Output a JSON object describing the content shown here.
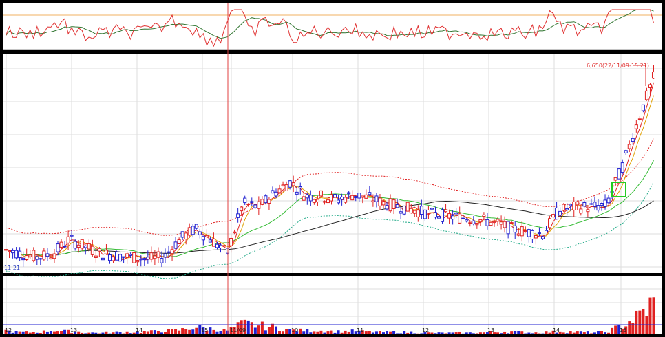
{
  "chart_data": {
    "type": "candlestick",
    "x_tick_labels": [
      "12",
      "13",
      "14",
      "15",
      "11/09",
      "10",
      "11",
      "12",
      "13",
      "14",
      "15"
    ],
    "price_annotation": "6,650(22/11/09-15:21)",
    "left_edge_label": "11:21",
    "grid": true,
    "panels": [
      "oscillator",
      "price",
      "volume"
    ],
    "colors": {
      "up": "#e02020",
      "down": "#2020d0",
      "ma_long": "#222222",
      "ma_mid": "#33bb33",
      "ma_short": "#e0a000",
      "band_upper": "#e02020",
      "band_lower": "#22aa88",
      "osc_fast": "#e03030",
      "osc_slow": "#337733",
      "cursor": "#e04040",
      "highlight_box": "#22cc22"
    },
    "close_approx": [
      5.0,
      4.9,
      4.8,
      4.9,
      5.3,
      5.1,
      4.9,
      4.85,
      4.8,
      4.75,
      4.8,
      5.3,
      5.6,
      5.3,
      4.9,
      6.3,
      6.2,
      6.6,
      6.9,
      6.5,
      6.5,
      6.4,
      6.55,
      6.45,
      6.3,
      6.2,
      6.1,
      6.0,
      5.95,
      5.9,
      5.85,
      5.75,
      5.6,
      5.5,
      5.45,
      6.1,
      6.2,
      6.2,
      6.25,
      7.3,
      8.6,
      9.8
    ],
    "volume_approx": [
      1,
      0.5,
      0.6,
      1,
      0.8,
      0.5,
      0.4,
      0.5,
      0.6,
      0.7,
      1,
      1.2,
      2,
      1.5,
      1,
      3,
      2.5,
      2,
      1.2,
      1,
      1,
      0.8,
      0.9,
      0.7,
      0.6,
      0.6,
      0.5,
      0.4,
      0.4,
      0.4,
      0.5,
      0.6,
      0.7,
      0.5,
      0.5,
      0.8,
      0.6,
      0.5,
      0.6,
      2.5,
      5,
      9
    ]
  }
}
